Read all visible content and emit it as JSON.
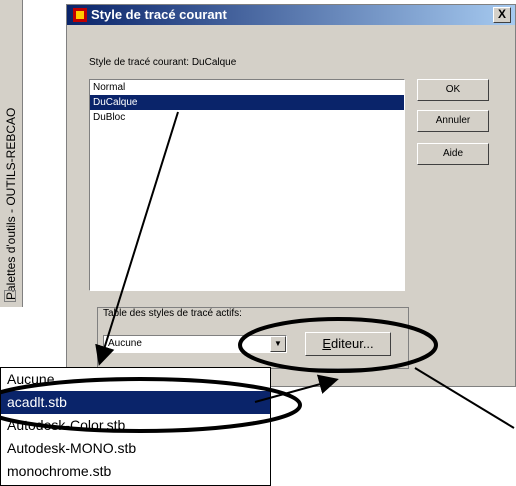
{
  "palette": {
    "title": "Palettes d'outils - OUTILS-REBCAO"
  },
  "dialog": {
    "title": "Style de tracé courant",
    "close_label": "X",
    "current_style_label": "Style de tracé courant: DuCalque",
    "styles": [
      "Normal",
      "DuCalque",
      "DuBloc"
    ],
    "selected_style": "DuCalque",
    "buttons": {
      "ok": "OK",
      "cancel": "Annuler",
      "help": "Aide"
    },
    "table_group_label": "Table des styles de tracé actifs:",
    "table_combo_value": "Aucune",
    "editor_label": "Editeur...",
    "editor_mnemonic": "E",
    "editor_rest": "diteur..."
  },
  "dropdown": {
    "items": [
      "Aucune",
      "acadlt.stb",
      "Autodesk-Color.stb",
      "Autodesk-MONO.stb",
      "monochrome.stb"
    ],
    "selected": "acadlt.stb"
  },
  "colors": {
    "titlebar": "#0a246a",
    "selection": "#0a246a",
    "face": "#d4d0c8"
  }
}
